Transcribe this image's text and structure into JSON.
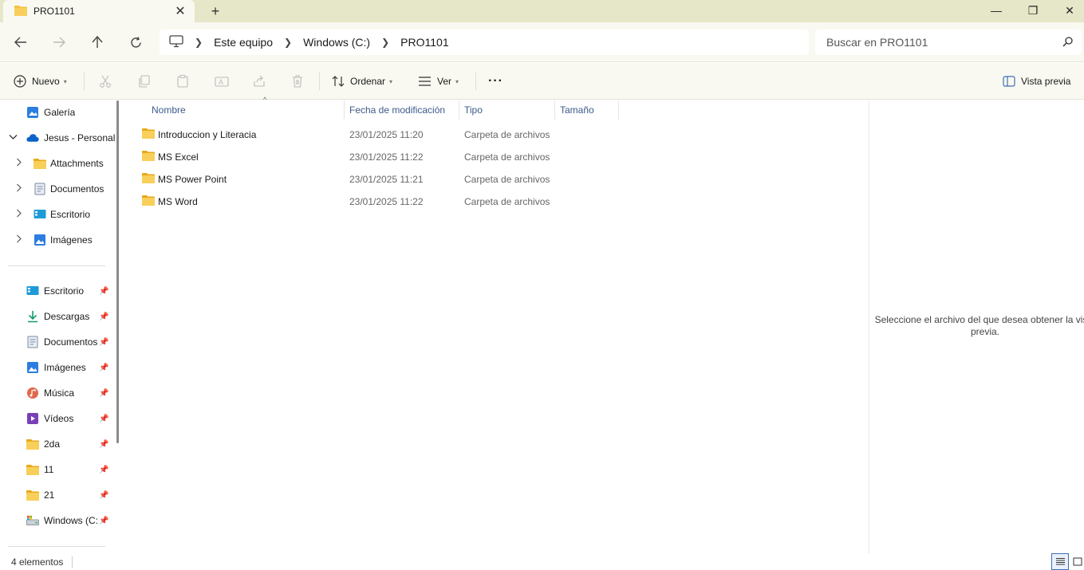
{
  "window": {
    "tab_title": "PRO1101",
    "tab_close": "✕",
    "new_tab": "+",
    "minimize": "—",
    "restore": "❐",
    "close": "✕"
  },
  "address": {
    "crumbs": [
      "Este equipo",
      "Windows (C:)",
      "PRO1101"
    ],
    "search_placeholder": "Buscar en PRO1101"
  },
  "toolbar": {
    "new_label": "Nuevo",
    "sort_label": "Ordenar",
    "view_label": "Ver",
    "more_label": "···",
    "preview_label": "Vista previa"
  },
  "sidebar": {
    "top_items": [
      {
        "label": "Galería",
        "icon": "gallery-icon"
      },
      {
        "label": "Jesus - Personal",
        "icon": "onedrive-icon"
      },
      {
        "label": "Attachments",
        "icon": "folder-icon"
      },
      {
        "label": "Documentos",
        "icon": "documents-icon"
      },
      {
        "label": "Escritorio",
        "icon": "desktop-icon"
      },
      {
        "label": "Imágenes",
        "icon": "pictures-icon"
      }
    ],
    "pinned_items": [
      {
        "label": "Escritorio",
        "icon": "desktop-icon"
      },
      {
        "label": "Descargas",
        "icon": "download-icon"
      },
      {
        "label": "Documentos",
        "icon": "documents-icon"
      },
      {
        "label": "Imágenes",
        "icon": "pictures-icon"
      },
      {
        "label": "Música",
        "icon": "music-icon"
      },
      {
        "label": "Vídeos",
        "icon": "videos-icon"
      },
      {
        "label": "2da",
        "icon": "folder-icon"
      },
      {
        "label": "11",
        "icon": "folder-icon"
      },
      {
        "label": "21",
        "icon": "folder-icon"
      },
      {
        "label": "Windows (C:",
        "icon": "drive-icon"
      }
    ]
  },
  "columns": {
    "name": "Nombre",
    "date": "Fecha de modificación",
    "type": "Tipo",
    "size": "Tamaño"
  },
  "files": [
    {
      "name": "Introduccion y Literacia",
      "date": "23/01/2025 11:20",
      "type": "Carpeta de archivos"
    },
    {
      "name": "MS Excel",
      "date": "23/01/2025 11:22",
      "type": "Carpeta de archivos"
    },
    {
      "name": "MS Power Point",
      "date": "23/01/2025 11:21",
      "type": "Carpeta de archivos"
    },
    {
      "name": "MS Word",
      "date": "23/01/2025 11:22",
      "type": "Carpeta de archivos"
    }
  ],
  "preview": {
    "message": "Seleccione el archivo del que desea obtener la vista previa."
  },
  "status": {
    "count": "4 elementos"
  },
  "colors": {
    "titlebar": "#e6e6c8",
    "toolbar": "#f9f9f1",
    "folder": "#f4c042",
    "accent": "#3d6fb6"
  }
}
